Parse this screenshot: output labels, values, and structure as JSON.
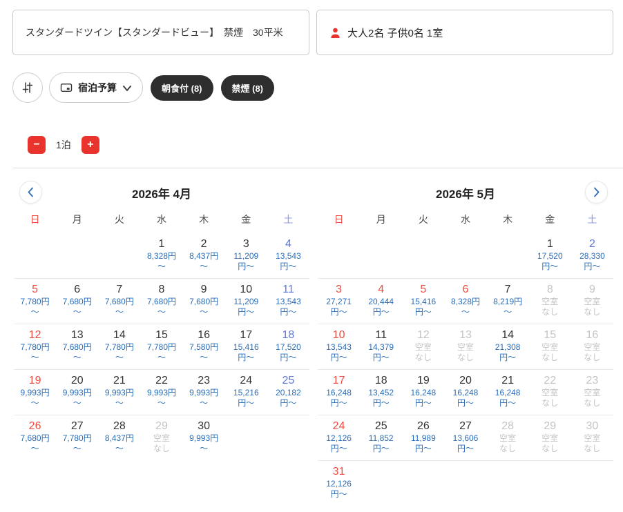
{
  "selectors": {
    "room": {
      "label": "スタンダードツイン【スタンダードビュー】　禁煙　30平米"
    },
    "guests": {
      "label": "大人2名  子供0名  1室"
    }
  },
  "filters": {
    "budget_button": {
      "label": "宿泊予算"
    },
    "chips": [
      {
        "label": "朝食付 (8)"
      },
      {
        "label": "禁煙 (8)"
      }
    ]
  },
  "stay_stepper": {
    "minus": "−",
    "label": "1泊",
    "plus": "+"
  },
  "calendar": {
    "weekday_labels": [
      "日",
      "月",
      "火",
      "水",
      "木",
      "金",
      "土"
    ],
    "yen": "円",
    "tilde": "〜",
    "no_vacancy_lines": [
      "空室",
      "なし"
    ],
    "months": [
      {
        "title": "2026年 4月",
        "nav": "prev",
        "weeks": [
          [
            null,
            null,
            null,
            {
              "day": 1,
              "price": "8,328",
              "color": "dark"
            },
            {
              "day": 2,
              "price": "8,437",
              "color": "dark"
            },
            {
              "day": 3,
              "price": "11,209",
              "color": "dark"
            },
            {
              "day": 4,
              "price": "13,543",
              "color": "blue"
            }
          ],
          [
            {
              "day": 5,
              "price": "7,780",
              "color": "red"
            },
            {
              "day": 6,
              "price": "7,680",
              "color": "dark"
            },
            {
              "day": 7,
              "price": "7,680",
              "color": "dark"
            },
            {
              "day": 8,
              "price": "7,680",
              "color": "dark"
            },
            {
              "day": 9,
              "price": "7,680",
              "color": "dark"
            },
            {
              "day": 10,
              "price": "11,209",
              "color": "dark"
            },
            {
              "day": 11,
              "price": "13,543",
              "color": "blue"
            }
          ],
          [
            {
              "day": 12,
              "price": "7,780",
              "color": "red"
            },
            {
              "day": 13,
              "price": "7,680",
              "color": "dark"
            },
            {
              "day": 14,
              "price": "7,780",
              "color": "dark"
            },
            {
              "day": 15,
              "price": "7,780",
              "color": "dark"
            },
            {
              "day": 16,
              "price": "7,580",
              "color": "dark"
            },
            {
              "day": 17,
              "price": "15,416",
              "color": "dark"
            },
            {
              "day": 18,
              "price": "17,520",
              "color": "blue"
            }
          ],
          [
            {
              "day": 19,
              "price": "9,993",
              "color": "red"
            },
            {
              "day": 20,
              "price": "9,993",
              "color": "dark"
            },
            {
              "day": 21,
              "price": "9,993",
              "color": "dark"
            },
            {
              "day": 22,
              "price": "9,993",
              "color": "dark"
            },
            {
              "day": 23,
              "price": "9,993",
              "color": "dark"
            },
            {
              "day": 24,
              "price": "15,216",
              "color": "dark"
            },
            {
              "day": 25,
              "price": "20,182",
              "color": "blue"
            }
          ],
          [
            {
              "day": 26,
              "price": "7,680",
              "color": "red"
            },
            {
              "day": 27,
              "price": "7,780",
              "color": "dark"
            },
            {
              "day": 28,
              "price": "8,437",
              "color": "dark"
            },
            {
              "day": 29,
              "soldout": true
            },
            {
              "day": 30,
              "price": "9,993",
              "color": "dark"
            },
            null,
            null
          ]
        ]
      },
      {
        "title": "2026年 5月",
        "nav": "next",
        "weeks": [
          [
            null,
            null,
            null,
            null,
            null,
            {
              "day": 1,
              "price": "17,520",
              "color": "dark"
            },
            {
              "day": 2,
              "price": "28,330",
              "color": "blue"
            }
          ],
          [
            {
              "day": 3,
              "price": "27,271",
              "color": "red"
            },
            {
              "day": 4,
              "price": "20,444",
              "color": "red"
            },
            {
              "day": 5,
              "price": "15,416",
              "color": "red"
            },
            {
              "day": 6,
              "price": "8,328",
              "color": "red"
            },
            {
              "day": 7,
              "price": "8,219",
              "color": "dark"
            },
            {
              "day": 8,
              "soldout": true
            },
            {
              "day": 9,
              "soldout": true
            }
          ],
          [
            {
              "day": 10,
              "price": "13,543",
              "color": "red"
            },
            {
              "day": 11,
              "price": "14,379",
              "color": "dark"
            },
            {
              "day": 12,
              "soldout": true
            },
            {
              "day": 13,
              "soldout": true
            },
            {
              "day": 14,
              "price": "21,308",
              "color": "dark"
            },
            {
              "day": 15,
              "soldout": true
            },
            {
              "day": 16,
              "soldout": true
            }
          ],
          [
            {
              "day": 17,
              "price": "16,248",
              "color": "red"
            },
            {
              "day": 18,
              "price": "13,452",
              "color": "dark"
            },
            {
              "day": 19,
              "price": "16,248",
              "color": "dark"
            },
            {
              "day": 20,
              "price": "16,248",
              "color": "dark"
            },
            {
              "day": 21,
              "price": "16,248",
              "color": "dark"
            },
            {
              "day": 22,
              "soldout": true
            },
            {
              "day": 23,
              "soldout": true
            }
          ],
          [
            {
              "day": 24,
              "price": "12,126",
              "color": "red"
            },
            {
              "day": 25,
              "price": "11,852",
              "color": "dark"
            },
            {
              "day": 26,
              "price": "11,989",
              "color": "dark"
            },
            {
              "day": 27,
              "price": "13,606",
              "color": "dark"
            },
            {
              "day": 28,
              "soldout": true
            },
            {
              "day": 29,
              "soldout": true
            },
            {
              "day": 30,
              "soldout": true
            }
          ],
          [
            {
              "day": 31,
              "price": "12,126",
              "color": "red"
            },
            null,
            null,
            null,
            null,
            null,
            null
          ]
        ]
      }
    ]
  },
  "colors": {
    "accent_red": "#e8342c",
    "chip_bg": "#2e2e2e",
    "price_blue": "#2a6cb8",
    "sunday_red": "#ef4b40",
    "saturday_blue": "#5e77d8",
    "saturday_header_blue": "#8b9ce0",
    "soldout_gray": "#c4c4c4",
    "day_dark": "#333333",
    "nav_chevron_blue": "#2a6cb8"
  }
}
